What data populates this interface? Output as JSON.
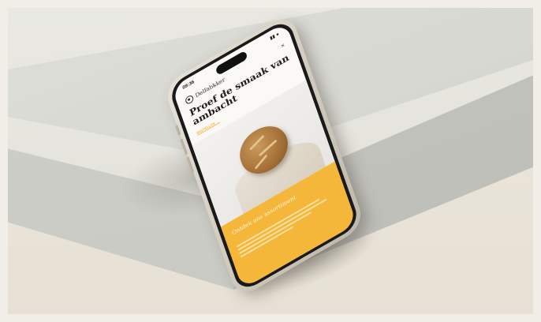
{
  "phone": {
    "status_time": "09:36",
    "status_icons": "▮▮ ●",
    "brand_name": "Delfabkker",
    "close_glyph": "×",
    "headline": "Proef de smaak van ambacht",
    "cta_label": "BESTELLEN",
    "section_title": "Ontdek ons assortiment",
    "accent_color": "#f5b739",
    "body_line_count_shown": 4
  }
}
